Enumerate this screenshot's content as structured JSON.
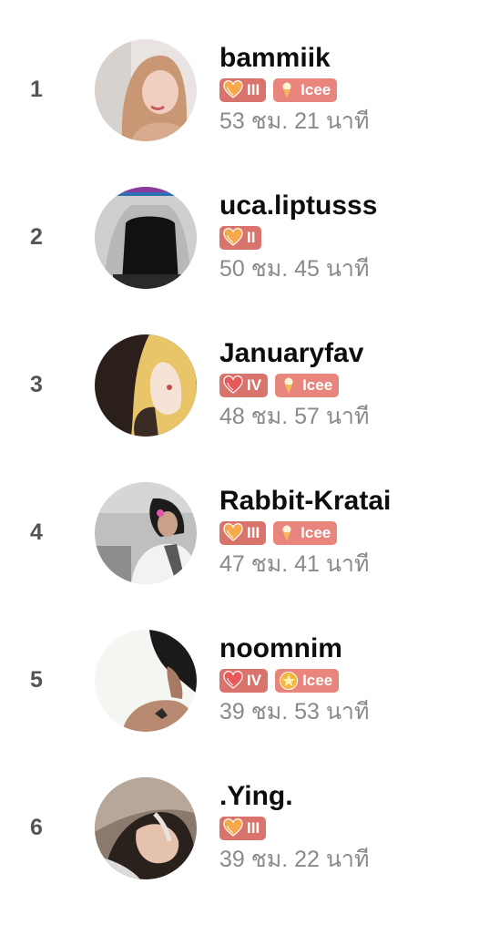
{
  "leaderboard": [
    {
      "rank": "1",
      "username": "bammiik",
      "level": "III",
      "fan": "Icee",
      "fan_icon": "ice-cream-icon",
      "duration": "53 ชม. 21 นาที",
      "avatar": "avatar-photo-woman-light"
    },
    {
      "rank": "2",
      "username": "uca.liptusss",
      "level": "II",
      "fan": "",
      "fan_icon": "",
      "duration": "50 ชม. 45 นาที",
      "avatar": "avatar-photo-dark-outfit"
    },
    {
      "rank": "3",
      "username": "Januaryfav",
      "level": "IV",
      "fan": "Icee",
      "fan_icon": "ice-cream-icon",
      "duration": "48 ชม. 57 นาที",
      "avatar": "avatar-anime-blonde"
    },
    {
      "rank": "4",
      "username": "Rabbit-Kratai",
      "level": "III",
      "fan": "Icee",
      "fan_icon": "ice-cream-icon",
      "duration": "47 ชม. 41 นาที",
      "avatar": "avatar-photo-girl-flower"
    },
    {
      "rank": "5",
      "username": "noomnim",
      "level": "IV",
      "fan": "Icee",
      "fan_icon": "gold-star-icon",
      "duration": "39 ชม. 53 นาที",
      "avatar": "avatar-photo-back-tattoo"
    },
    {
      "rank": "6",
      "username": ".Ying.",
      "level": "III",
      "fan": "",
      "fan_icon": "",
      "duration": "39 ชม. 22 นาที",
      "avatar": "avatar-photo-woman-lying"
    }
  ],
  "colors": {
    "level_badge": "#d9746d",
    "fan_badge": "#e8867e",
    "rank_text": "#555555",
    "duration_text": "#8a8a8a"
  }
}
